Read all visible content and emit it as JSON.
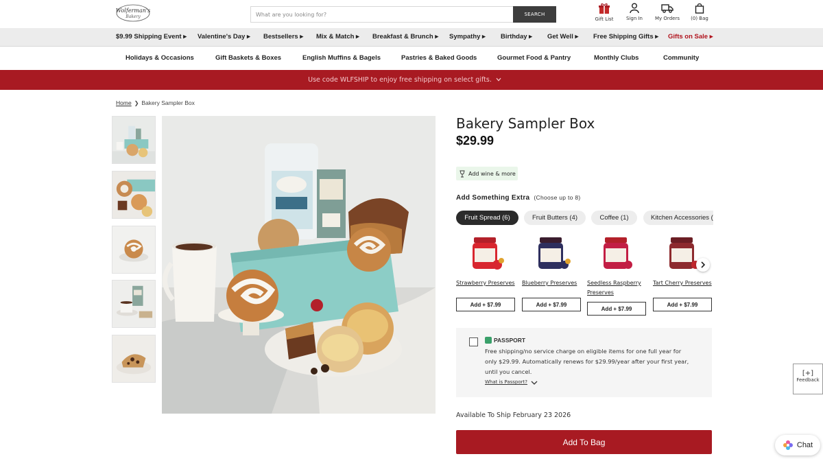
{
  "header": {
    "logo_line1": "Wolferman's",
    "logo_line2": "Bakery",
    "search_placeholder": "What are you looking for?",
    "search_button": "SEARCH",
    "icons": [
      {
        "label": "Gift List",
        "icon": "gift-icon"
      },
      {
        "label": "Sign In",
        "icon": "person-icon"
      },
      {
        "label": "My Orders",
        "icon": "truck-icon"
      },
      {
        "label": "(0) Bag",
        "icon": "bag-icon"
      }
    ]
  },
  "nav_primary": [
    "$9.99 Shipping Event ▸",
    "Valentine's Day ▸",
    "Bestsellers ▸",
    "Mix & Match ▸",
    "Breakfast & Brunch ▸",
    "Sympathy ▸",
    "Birthday ▸",
    "Get Well ▸",
    "Free Shipping Gifts ▸",
    "Gifts on Sale ▸"
  ],
  "nav_secondary": [
    "Holidays & Occasions",
    "Gift Baskets & Boxes",
    "English Muffins & Bagels",
    "Pastries & Baked Goods",
    "Gourmet Food & Pantry",
    "Monthly Clubs",
    "Community"
  ],
  "promo": {
    "text": "Use code WLFSHIP to enjoy free shipping on select gifts."
  },
  "breadcrumb": {
    "home": "Home",
    "sep": "❯",
    "current": "Bakery Sampler Box"
  },
  "product": {
    "title": "Bakery Sampler Box",
    "price": "$29.99",
    "wine_label": "Add wine & more",
    "add_extra_title": "Add Something Extra",
    "add_extra_sub": "(Choose up to 8)",
    "tabs": [
      "Fruit Spread (6)",
      "Fruit Butters (4)",
      "Coffee (1)",
      "Kitchen Accessories ("
    ],
    "extras": [
      {
        "name": "Strawberry Preserves",
        "button": "Add + $7.99",
        "lid": "#b3202a",
        "fruit": "#d8262f"
      },
      {
        "name": "Blueberry Preserves",
        "button": "Add + $7.99",
        "lid": "#3a1d2e",
        "fruit": "#2e2f5e"
      },
      {
        "name": "Seedless Raspberry Preserves",
        "button": "Add + $7.99",
        "lid": "#b3202a",
        "fruit": "#c21e44"
      },
      {
        "name": "Tart Cherry Preserves",
        "button": "Add + $7.99",
        "lid": "#6b1e24",
        "fruit": "#c1272d"
      }
    ],
    "passport": {
      "brand": "PASSPORT",
      "text": "Free shipping/no service charge on eligible items for one full year for only $29.99. Automatically renews for $29.99/year after your first year, until you cancel.",
      "link": "What is Passport?"
    },
    "availability": "Available To Ship February 23 2026",
    "add_to_bag": "Add To Bag"
  },
  "widgets": {
    "feedback_icon": "[+]",
    "feedback": "Feedback",
    "chat": "Chat"
  },
  "colors": {
    "brand_red": "#a81a22",
    "nav_bg": "#ececec",
    "sale_red": "#b0131d",
    "passport_green": "#3aa06a"
  }
}
